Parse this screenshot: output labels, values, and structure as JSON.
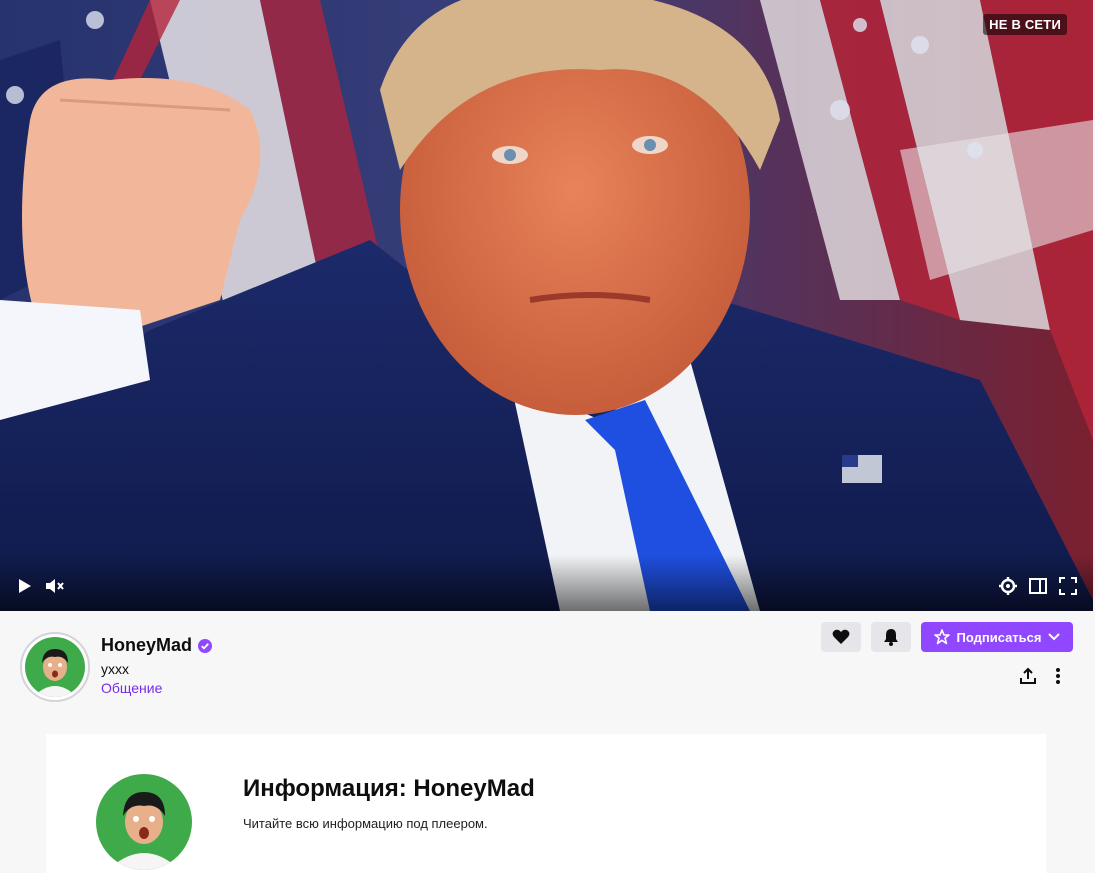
{
  "player": {
    "status": "НЕ В СЕТИ",
    "controls": {
      "play": "play-icon",
      "mute": "muted-speaker-icon",
      "settings": "gear-icon",
      "theatre": "theatre-mode-icon",
      "fullscreen": "fullscreen-icon"
    }
  },
  "channel": {
    "name": "HoneyMad",
    "verified": true,
    "title": "yxxx",
    "category": "Общение"
  },
  "actions": {
    "follow_icon": "heart-icon",
    "notify_icon": "bell-icon",
    "subscribe_label": "Подписаться",
    "share_icon": "share-icon",
    "more_icon": "more-vertical-icon"
  },
  "about": {
    "title": "Информация: HoneyMad",
    "subtitle": "Читайте всю информацию под плеером."
  },
  "colors": {
    "accent": "#9147ff",
    "category_link": "#772ce8"
  }
}
